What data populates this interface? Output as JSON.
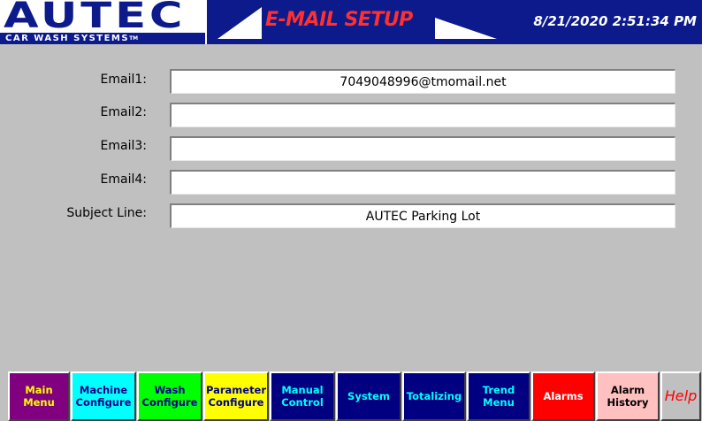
{
  "header": {
    "logo_word": "AUTEC",
    "logo_sub": "CAR WASH SYSTEMS",
    "logo_tm": "TM",
    "screen_title": "E-MAIL SETUP",
    "datetime": "8/21/2020 2:51:34 PM"
  },
  "form": {
    "fields": [
      {
        "label": "Email1:",
        "value": "7049048996@tmomail.net"
      },
      {
        "label": "Email2:",
        "value": ""
      },
      {
        "label": "Email3:",
        "value": ""
      },
      {
        "label": "Email4:",
        "value": ""
      },
      {
        "label": "Subject Line:",
        "value": "AUTEC Parking Lot"
      }
    ]
  },
  "nav": {
    "buttons": [
      {
        "label": "Main\nMenu",
        "bg": "#800080",
        "fg": "#ffff00"
      },
      {
        "label": "Machine\nConfigure",
        "bg": "#00ffff",
        "fg": "#00008b"
      },
      {
        "label": "Wash\nConfigure",
        "bg": "#00ff00",
        "fg": "#00008b"
      },
      {
        "label": "Parameter\nConfigure",
        "bg": "#ffff00",
        "fg": "#00008b"
      },
      {
        "label": "Manual\nControl",
        "bg": "#000080",
        "fg": "#00ffff"
      },
      {
        "label": "System",
        "bg": "#000080",
        "fg": "#00ffff"
      },
      {
        "label": "Totalizing",
        "bg": "#000080",
        "fg": "#00ffff"
      },
      {
        "label": "Trend\nMenu",
        "bg": "#000080",
        "fg": "#00ffff"
      },
      {
        "label": "Alarms",
        "bg": "#ff0000",
        "fg": "#ffffff"
      },
      {
        "label": "Alarm\nHistory",
        "bg": "#ffc0c0",
        "fg": "#000000"
      },
      {
        "label": "Help",
        "bg": "#c0c0c0",
        "fg": "#ff0000"
      }
    ]
  },
  "colors": {
    "header_bg": "#0c1a8c",
    "screen_bg": "#c0c0c0",
    "title_red": "#ff3030"
  }
}
